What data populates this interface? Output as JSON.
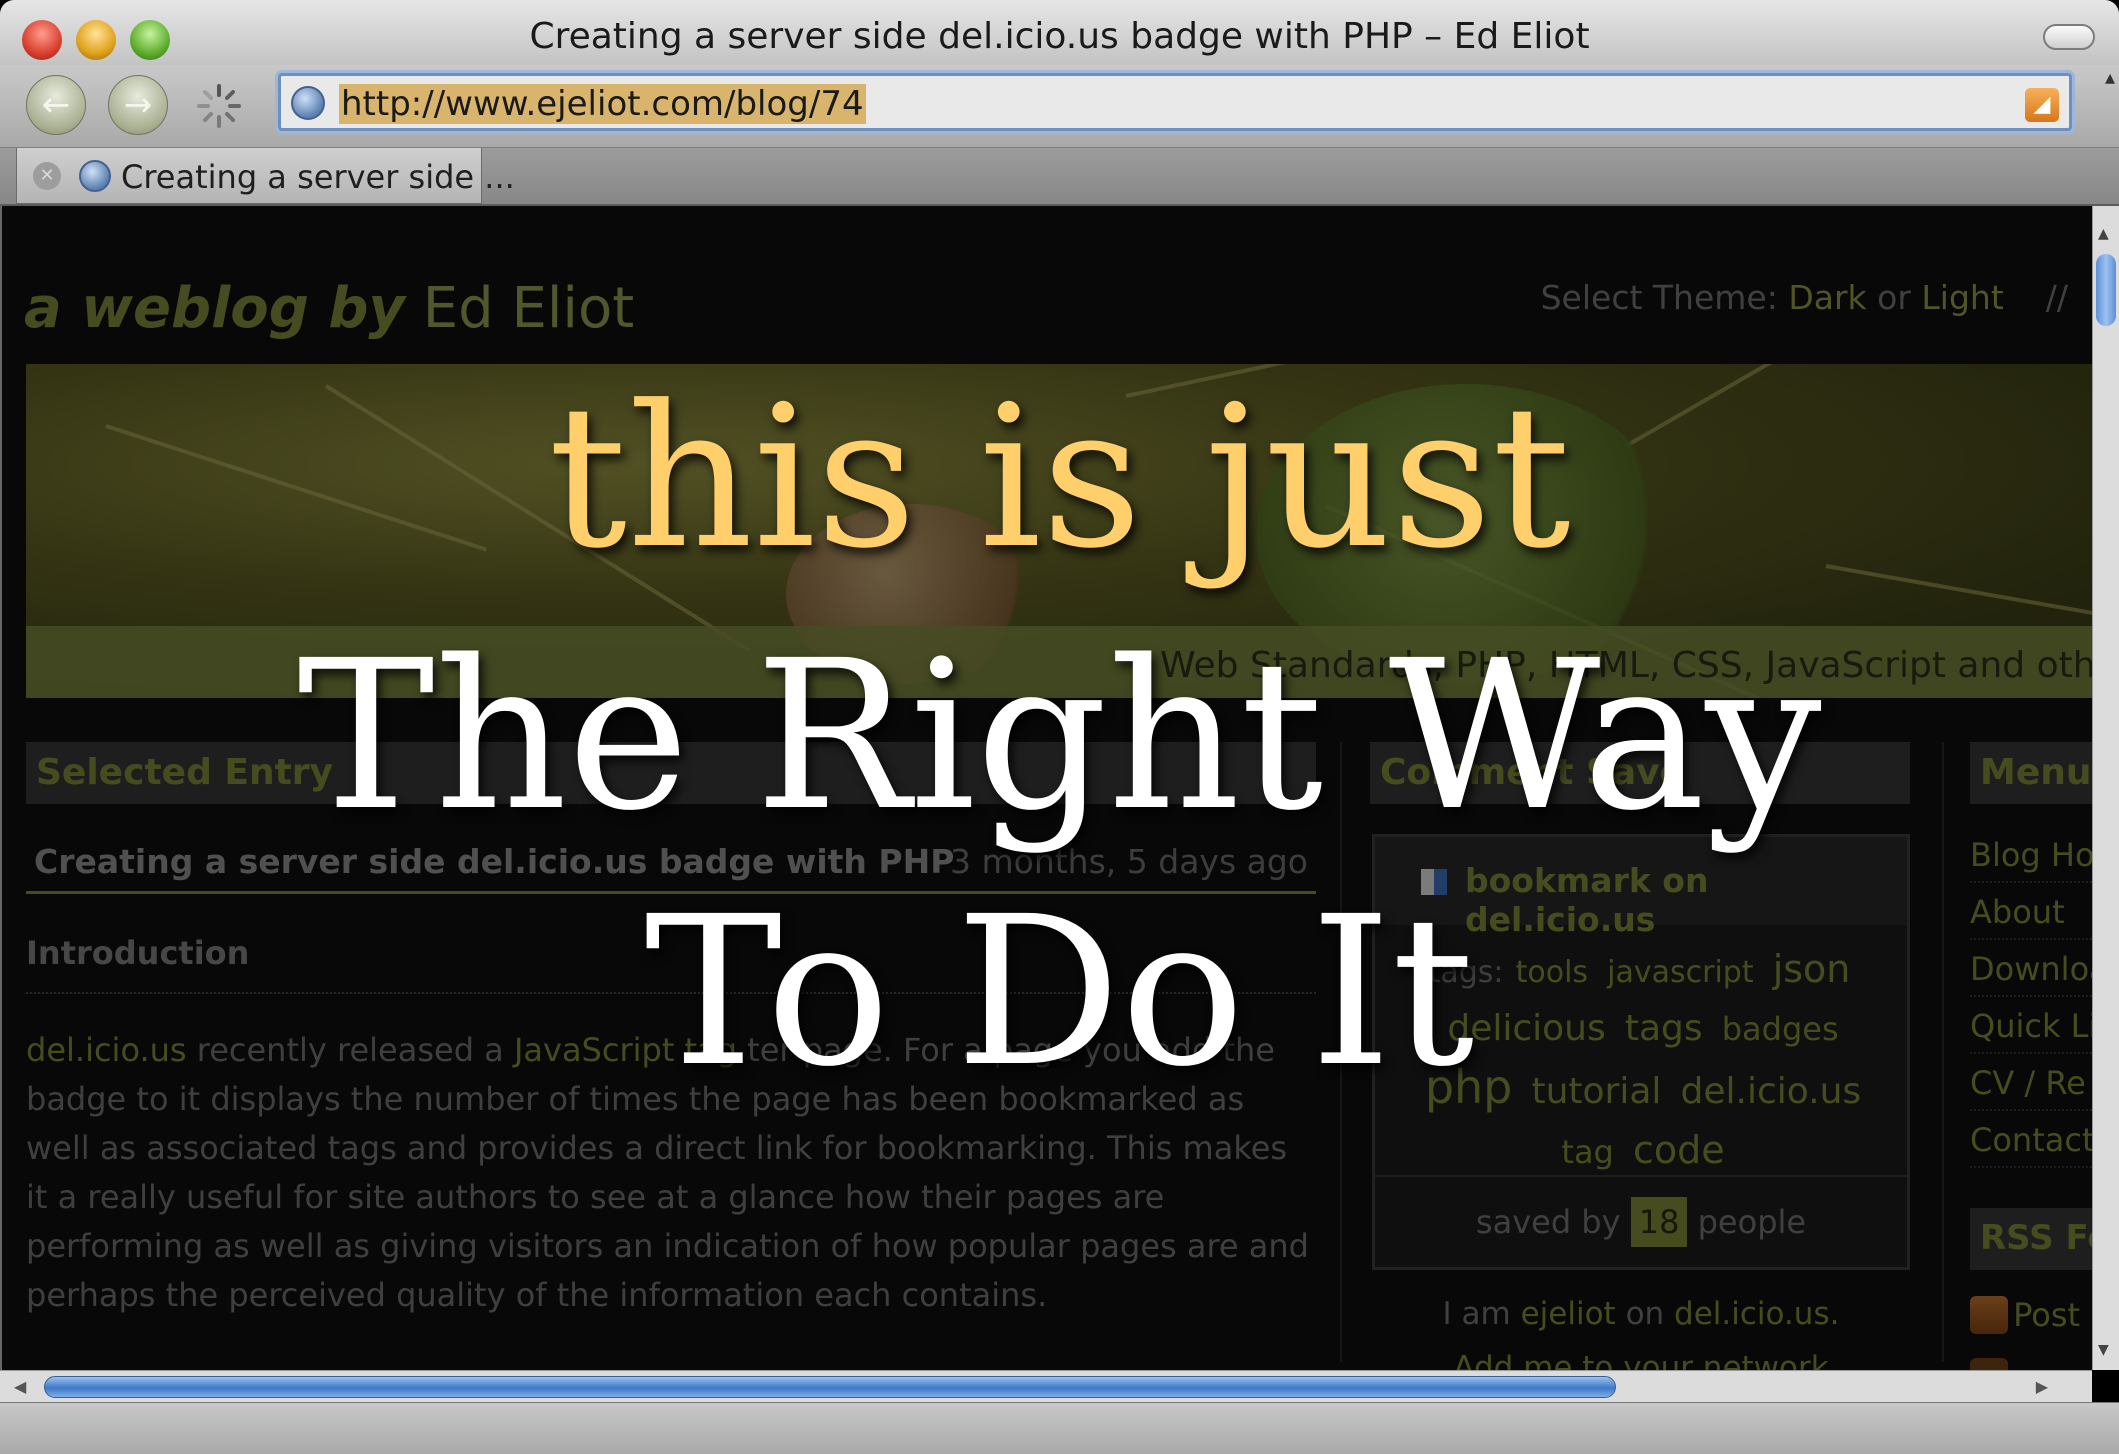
{
  "window": {
    "title": "Creating a server side del.icio.us badge with PHP – Ed Eliot"
  },
  "toolbar": {
    "back_icon": "back-arrow-icon",
    "forward_icon": "forward-arrow-icon",
    "url": "http://www.ejeliot.com/blog/74",
    "rss_icon": "rss-icon"
  },
  "tab": {
    "label": "Creating a server side ..."
  },
  "blog": {
    "title_prefix": "a weblog by",
    "title_name": "Ed Eliot",
    "theme_prefix": "Select Theme:",
    "theme_dark": "Dark",
    "theme_or": "or",
    "theme_light": "Light",
    "theme_sep": "//",
    "tagline": "Web Standards, PHP, HTML, CSS, JavaScript and othe"
  },
  "main": {
    "section_title": "Selected Entry",
    "entry_title": "Creating a server side del.icio.us badge with PHP",
    "entry_date": "3 months, 5 days ago",
    "intro_heading": "Introduction",
    "para_link1": "del.icio.us",
    "para_text1": " recently released a ",
    "para_link2": "JavaScript tag",
    "para_text2": " ter page. For a page you add the badge to it displays the number of times the page has been bookmarked as well as associated tags and provides a direct link for bookmarking. This makes it a really useful for site authors to see at a glance how their pages are performing as well as giving visitors an indication of how popular pages are and perhaps the perceived quality of the information each contains."
  },
  "sidebar": {
    "section_title": "Comment Save",
    "bookmark_label": "bookmark on del.icio.us",
    "tags_prefix": "tags:",
    "tags": [
      "tools",
      "javascript",
      "json",
      "delicious",
      "tags",
      "badges",
      "php",
      "tutorial",
      "del.icio.us",
      "tag",
      "code"
    ],
    "saved_prefix": "saved by",
    "saved_count": "18",
    "saved_suffix": "people",
    "iam_prefix": "I am",
    "iam_user": "ejeliot",
    "iam_mid": "on",
    "iam_site": "del.icio.us.",
    "add_me": "Add me to your network"
  },
  "menu": {
    "title": "Menu",
    "items": [
      "Blog Ho",
      "About",
      "Downloa",
      "Quick Li",
      "CV / Re",
      "Contact"
    ],
    "rss_title": "RSS Fe",
    "rss_item": "Post"
  },
  "slide": {
    "line1": "this is just",
    "line2": "The Right Way",
    "line3": "To Do It"
  },
  "colors": {
    "accent_gold": "#ffcf6b",
    "slide_white": "#ffffff",
    "blog_olive": "#7b8436"
  }
}
